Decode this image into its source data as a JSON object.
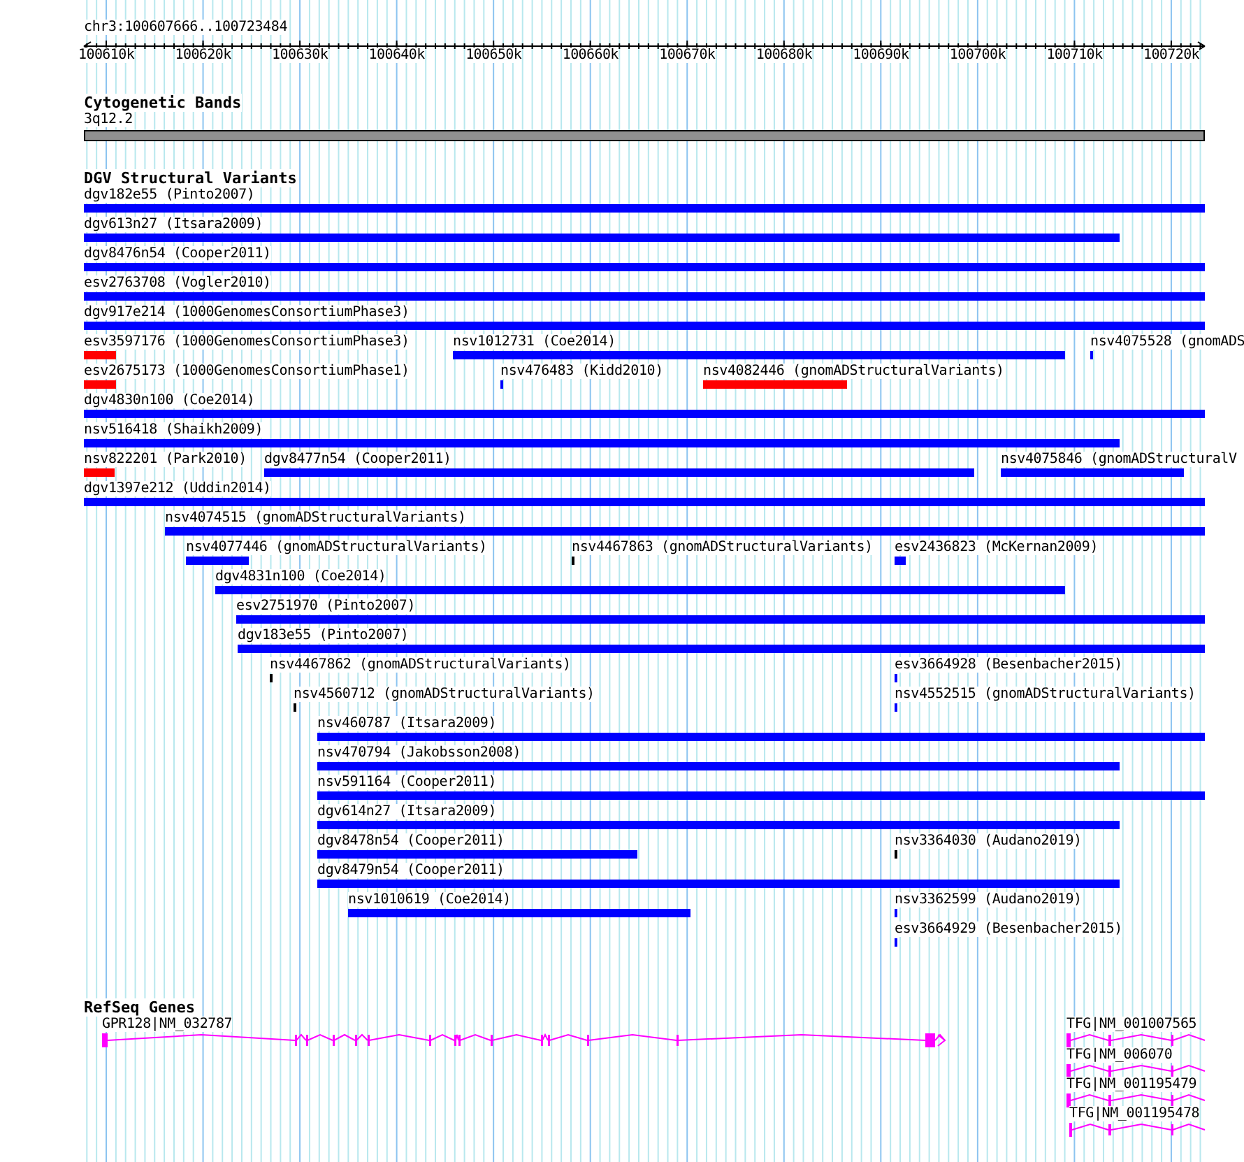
{
  "ruler": {
    "location": "chr3:100607666..100723484",
    "ticks": [
      "100610k",
      "100620k",
      "100630k",
      "100640k",
      "100650k",
      "100660k",
      "100670k",
      "100680k",
      "100690k",
      "100700k",
      "100710k",
      "100720k"
    ]
  },
  "cytogenetic_bands": {
    "title": "Cytogenetic Bands",
    "band": "3q12.2"
  },
  "dgv_structural_variants": {
    "title": "DGV Structural Variants",
    "rows": [
      {
        "features": [
          {
            "label": "dgv182e55 (Pinto2007)",
            "color": "#0000ff"
          }
        ]
      },
      {
        "features": [
          {
            "label": "dgv613n27 (Itsara2009)",
            "color": "#0000ff"
          }
        ]
      },
      {
        "features": [
          {
            "label": "dgv8476n54 (Cooper2011)",
            "color": "#0000ff"
          }
        ]
      },
      {
        "features": [
          {
            "label": "esv2763708 (Vogler2010)",
            "color": "#0000ff"
          }
        ]
      },
      {
        "features": [
          {
            "label": "dgv917e214 (1000GenomesConsortiumPhase3)",
            "color": "#0000ff"
          }
        ]
      },
      {
        "features": [
          {
            "label": "esv3597176 (1000GenomesConsortiumPhase3)",
            "color": "#ff0000"
          },
          {
            "label": "nsv1012731 (Coe2014)",
            "color": "#0000ff"
          },
          {
            "label": "nsv4075528 (gnomADS",
            "color": "#0000ff"
          }
        ]
      },
      {
        "features": [
          {
            "label": "esv2675173 (1000GenomesConsortiumPhase1)",
            "color": "#ff0000"
          },
          {
            "label": "nsv476483 (Kidd2010)",
            "color": "#0000ff"
          },
          {
            "label": "nsv4082446 (gnomADStructuralVariants)",
            "color": "#ff0000"
          }
        ]
      },
      {
        "features": [
          {
            "label": "dgv4830n100 (Coe2014)",
            "color": "#0000ff"
          }
        ]
      },
      {
        "features": [
          {
            "label": "nsv516418 (Shaikh2009)",
            "color": "#0000ff"
          }
        ]
      },
      {
        "features": [
          {
            "label": "nsv822201 (Park2010)",
            "color": "#ff0000"
          },
          {
            "label": "dgv8477n54 (Cooper2011)",
            "color": "#0000ff"
          },
          {
            "label": "nsv4075846 (gnomADStructuralV",
            "color": "#0000ff"
          }
        ]
      },
      {
        "features": [
          {
            "label": "dgv1397e212 (Uddin2014)",
            "color": "#0000ff"
          }
        ]
      },
      {
        "features": [
          {
            "label": "nsv4074515 (gnomADStructuralVariants)",
            "color": "#0000ff"
          }
        ]
      },
      {
        "features": [
          {
            "label": "nsv4077446 (gnomADStructuralVariants)",
            "color": "#0000ff"
          },
          {
            "label": "nsv4467863 (gnomADStructuralVariants)",
            "color": "#000000"
          },
          {
            "label": "esv2436823 (McKernan2009)",
            "color": "#0000ff"
          }
        ]
      },
      {
        "features": [
          {
            "label": "dgv4831n100 (Coe2014)",
            "color": "#0000ff"
          }
        ]
      },
      {
        "features": [
          {
            "label": "esv2751970 (Pinto2007)",
            "color": "#0000ff"
          }
        ]
      },
      {
        "features": [
          {
            "label": "dgv183e55 (Pinto2007)",
            "color": "#0000ff"
          }
        ]
      },
      {
        "features": [
          {
            "label": "nsv4467862 (gnomADStructuralVariants)",
            "color": "#000000"
          },
          {
            "label": "esv3664928 (Besenbacher2015)",
            "color": "#0000ff"
          }
        ]
      },
      {
        "features": [
          {
            "label": "nsv4560712 (gnomADStructuralVariants)",
            "color": "#000000"
          },
          {
            "label": "nsv4552515 (gnomADStructuralVariants)",
            "color": "#0000ff"
          }
        ]
      },
      {
        "features": [
          {
            "label": "nsv460787 (Itsara2009)",
            "color": "#0000ff"
          }
        ]
      },
      {
        "features": [
          {
            "label": "nsv470794 (Jakobsson2008)",
            "color": "#0000ff"
          }
        ]
      },
      {
        "features": [
          {
            "label": "nsv591164 (Cooper2011)",
            "color": "#0000ff"
          }
        ]
      },
      {
        "features": [
          {
            "label": "dgv614n27 (Itsara2009)",
            "color": "#0000ff"
          }
        ]
      },
      {
        "features": [
          {
            "label": "dgv8478n54 (Cooper2011)",
            "color": "#0000ff"
          },
          {
            "label": "nsv3364030 (Audano2019)",
            "color": "#000000"
          }
        ]
      },
      {
        "features": [
          {
            "label": "dgv8479n54 (Cooper2011)",
            "color": "#0000ff"
          }
        ]
      },
      {
        "features": [
          {
            "label": "nsv1010619 (Coe2014)",
            "color": "#0000ff"
          },
          {
            "label": "nsv3362599 (Audano2019)",
            "color": "#0000ff"
          }
        ]
      },
      {
        "features": [
          {
            "label": "esv3664929 (Besenbacher2015)",
            "color": "#0000ff"
          }
        ]
      }
    ]
  },
  "refseq_genes": {
    "title": "RefSeq Genes",
    "genes": [
      {
        "label": "GPR128|NM_032787"
      },
      {
        "label": "TFG|NM_001007565"
      },
      {
        "label": "TFG|NM_006070"
      },
      {
        "label": "TFG|NM_001195479"
      },
      {
        "label": "TFG|NM_001195478"
      }
    ]
  }
}
